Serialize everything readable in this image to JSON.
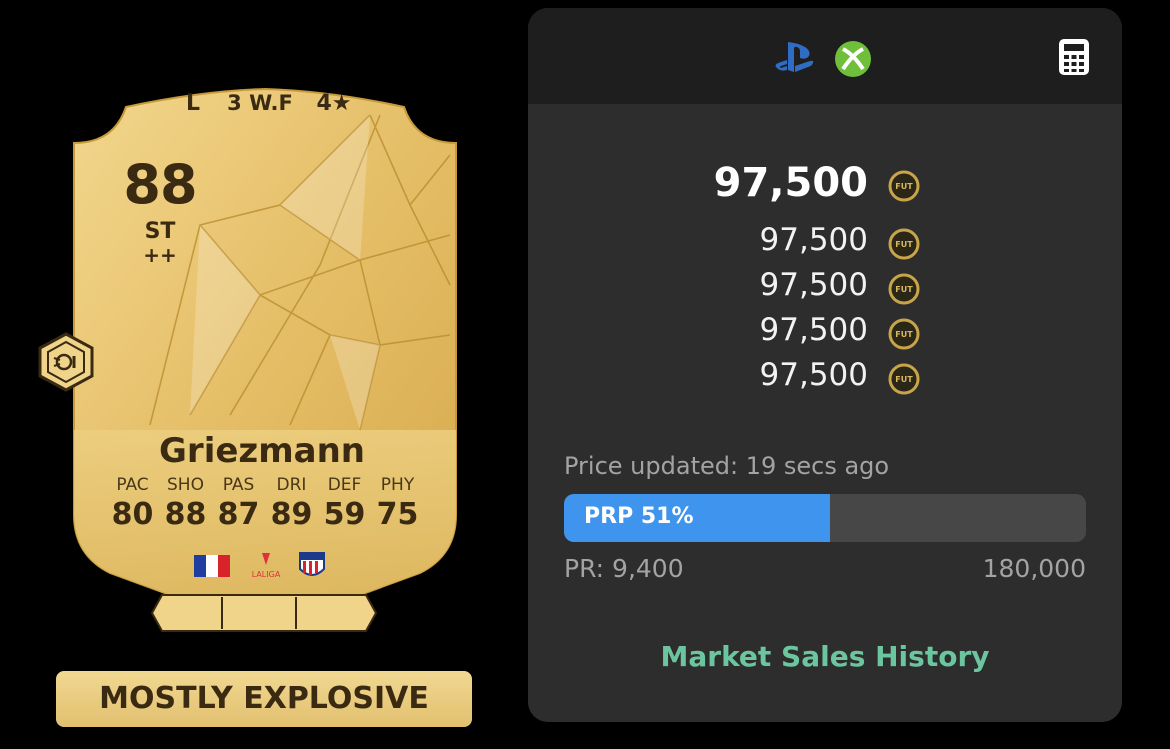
{
  "card": {
    "rating": "88",
    "position": "ST",
    "plus": "++",
    "name": "Griezmann",
    "stat_labels": [
      "PAC",
      "SHO",
      "PAS",
      "DRI",
      "DEF",
      "PHY"
    ],
    "stat_values": [
      "80",
      "88",
      "87",
      "89",
      "59",
      "75"
    ],
    "league_text": "LALIGA",
    "traits": {
      "foot": "L",
      "weak_foot": "3 W.F",
      "skill": "4★"
    },
    "playstyle_icon": "playstyle-plus-icon",
    "label": "MOSTLY EXPLOSIVE"
  },
  "panel": {
    "platform_icons": [
      "playstation-icon",
      "xbox-icon"
    ],
    "calculator_icon": "calculator-icon",
    "prices": [
      "97,500",
      "97,500",
      "97,500",
      "97,500",
      "97,500"
    ],
    "coin_text": "FUT",
    "updated": "Price updated: 19 secs ago",
    "prp_label": "PRP 51%",
    "prp_value": 0.51,
    "pr_min": "PR: 9,400",
    "pr_max": "180,000",
    "market_link": "Market Sales History",
    "colors": {
      "accent_blue": "#3f94ee",
      "link_green": "#6bc6a0",
      "gold": "#e2c070"
    }
  }
}
